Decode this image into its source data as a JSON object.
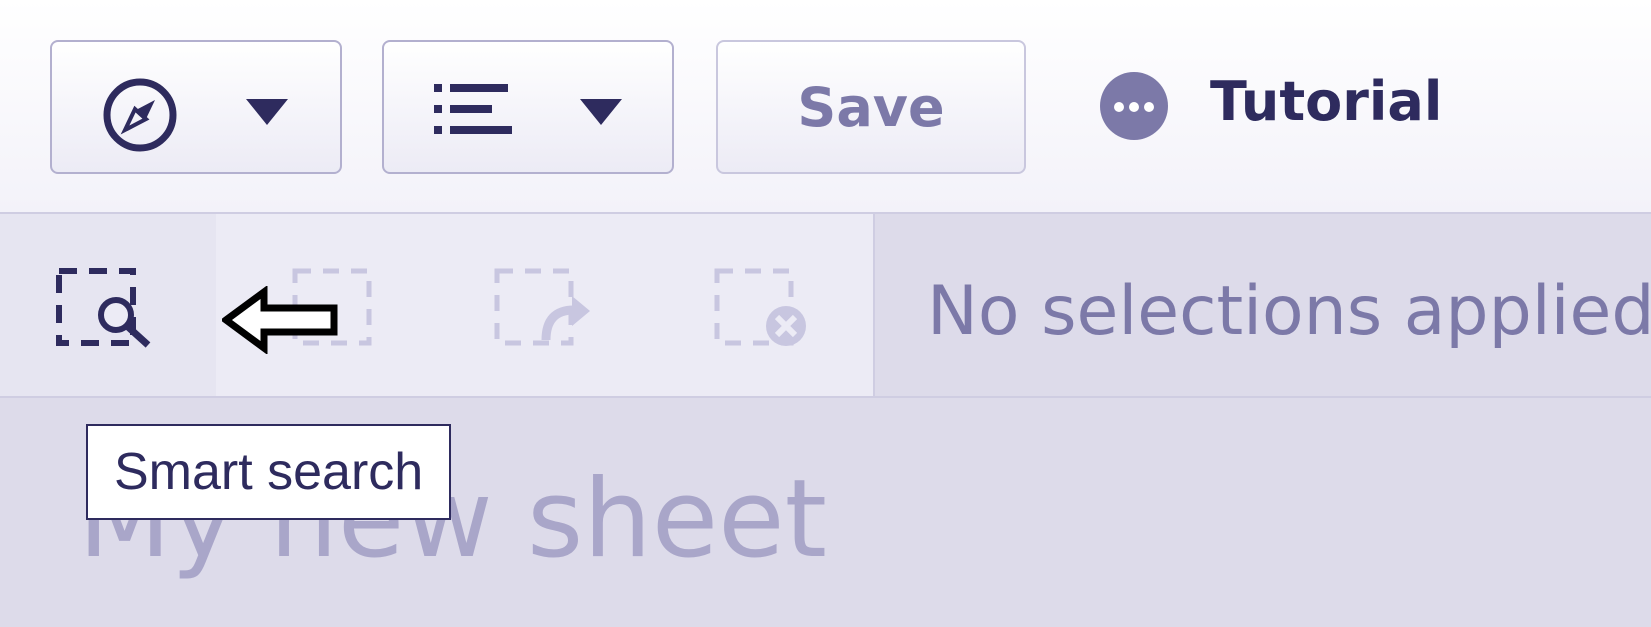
{
  "toolbar": {
    "navigate_icon": "compass-icon",
    "list_icon": "list-icon",
    "save_label": "Save",
    "tutorial_icon": "more-dots-icon",
    "tutorial_label": "Tutorial"
  },
  "selections": {
    "tools": [
      "smart-search-icon",
      "step-back-icon",
      "step-forward-icon",
      "clear-all-icon"
    ],
    "status_text": "No selections applied"
  },
  "sheet": {
    "title": "My new sheet"
  },
  "tooltip": {
    "text": "Smart search"
  },
  "annotation": {
    "icon": "left-arrow-icon"
  },
  "colors": {
    "accent_dark": "#2e2b5e",
    "accent_muted": "#7c79a8",
    "disabled": "#c8c6e0",
    "background": "#dddbea"
  }
}
